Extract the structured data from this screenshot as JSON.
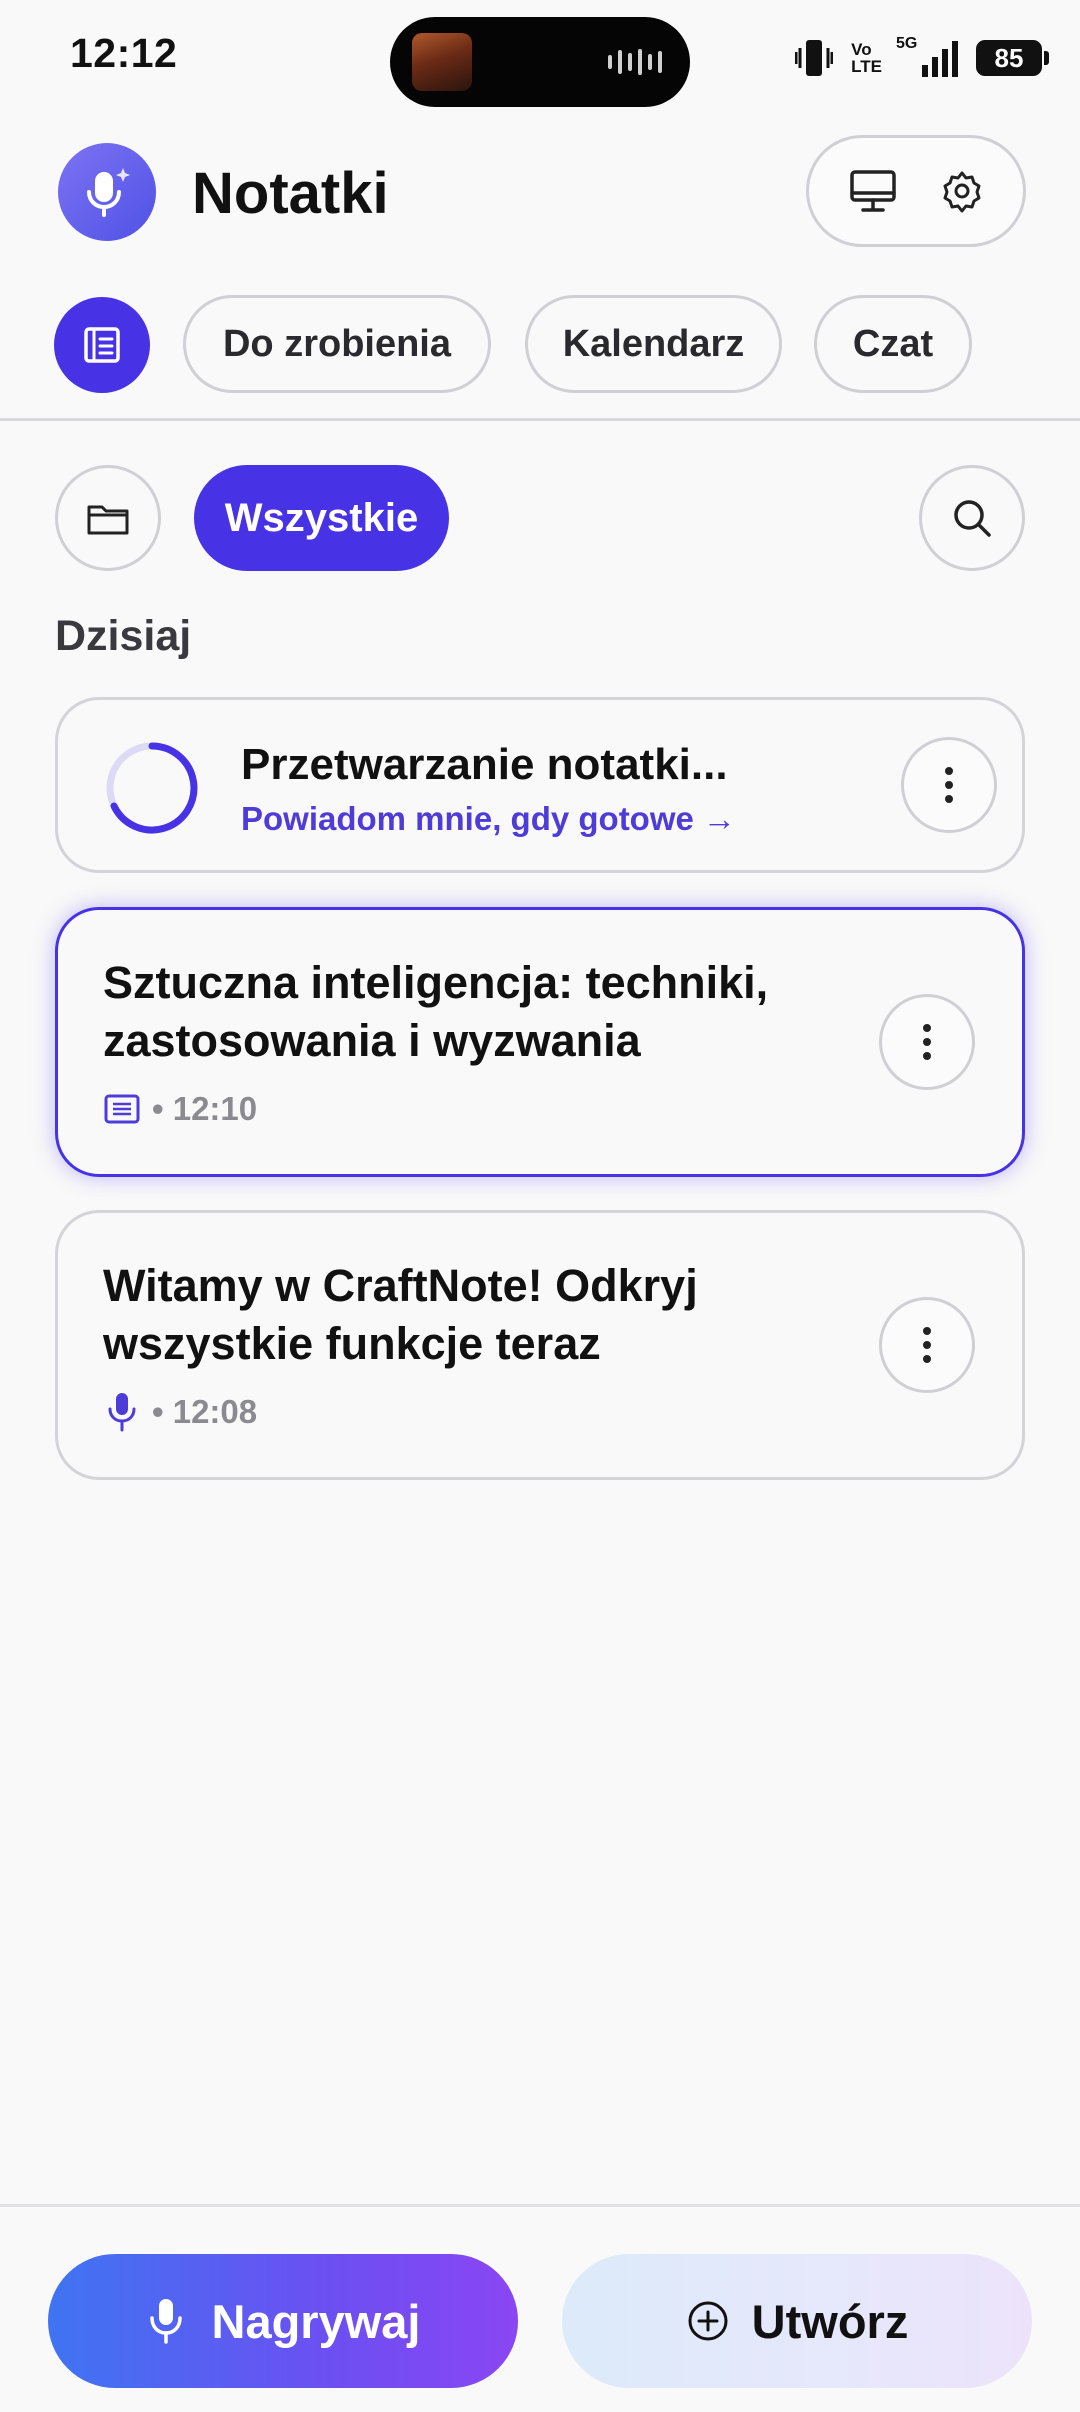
{
  "status_bar": {
    "time": "12:12",
    "network": "VoLTE",
    "network_line1": "Vo",
    "network_line2": "LTE",
    "signal": "5G",
    "battery": "85"
  },
  "header": {
    "title": "Notatki"
  },
  "tabs": [
    {
      "label": "Do zrobienia"
    },
    {
      "label": "Kalendarz"
    },
    {
      "label": "Czat"
    }
  ],
  "filters": {
    "all_label": "Wszystkie"
  },
  "section_title": "Dzisiaj",
  "processing_card": {
    "title": "Przetwarzanie notatki...",
    "subtitle": "Powiadom mnie, gdy gotowe →"
  },
  "notes": [
    {
      "title_line1": "Sztuczna inteligencja: techniki,",
      "title_line2": "zastosowania i wyzwania",
      "type_icon": "document-icon",
      "time": "• 12:10"
    },
    {
      "title_line1": "Witamy w CraftNote! Odkryj",
      "title_line2": "wszystkie funkcje teraz",
      "type_icon": "microphone-icon",
      "time": "• 12:08"
    }
  ],
  "bottom": {
    "record_label": "Nagrywaj",
    "create_label": "Utwórz"
  },
  "colors": {
    "accent": "#4733e5",
    "accent_text": "#4f3bd8"
  }
}
